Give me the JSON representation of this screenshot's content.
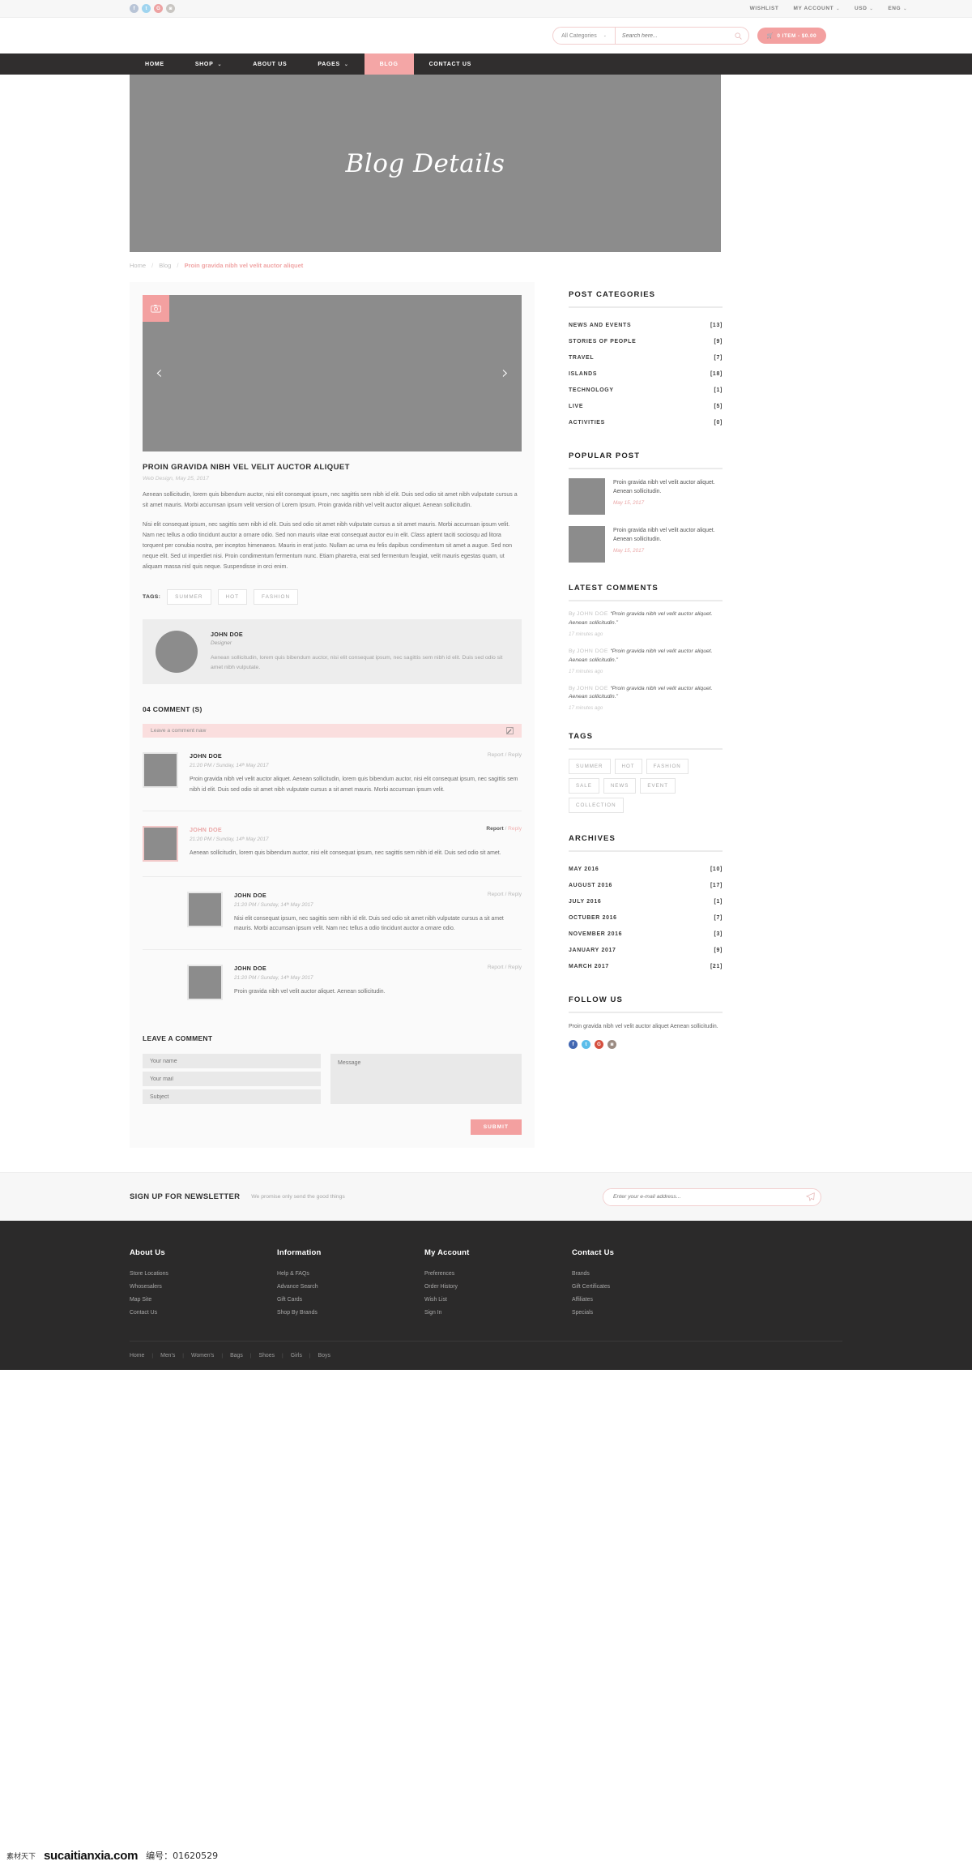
{
  "topbar": {
    "socials": [
      {
        "name": "facebook-icon",
        "glyph": "f"
      },
      {
        "name": "twitter-icon",
        "glyph": "t"
      },
      {
        "name": "googleplus-icon",
        "glyph": "G"
      },
      {
        "name": "instagram-icon",
        "glyph": "◙"
      }
    ],
    "links": [
      {
        "label": "WISHLIST",
        "caret": false
      },
      {
        "label": "MY ACCOUNT",
        "caret": true
      },
      {
        "label": "USD",
        "caret": true
      },
      {
        "label": "ENG",
        "caret": true
      }
    ]
  },
  "header": {
    "category_select": "All Categories",
    "search_placeholder": "Search here...",
    "search_value": "",
    "cart_label": "0 ITEM - $0.00"
  },
  "mainnav": [
    {
      "label": "HOME",
      "caret": false,
      "active": false
    },
    {
      "label": "SHOP",
      "caret": true,
      "active": false
    },
    {
      "label": "ABOUT US",
      "caret": false,
      "active": false
    },
    {
      "label": "PAGES",
      "caret": true,
      "active": false
    },
    {
      "label": "BLOG",
      "caret": false,
      "active": true
    },
    {
      "label": "CONTACT US",
      "caret": false,
      "active": false
    }
  ],
  "hero": {
    "title": "Blog Details"
  },
  "breadcrumb": {
    "home": "Home",
    "blog": "Blog",
    "current": "Proin gravida nibh vel velit auctor aliquet",
    "separator": "/"
  },
  "post": {
    "title": "PROIN GRAVIDA NIBH VEL VELIT AUCTOR ALIQUET",
    "meta": "Web Design, May 25, 2017",
    "paragraph1": "Aenean sollicitudin, lorem quis bibendum auctor, nisi elit consequat ipsum, nec sagittis sem nibh id elit. Duis sed odio sit amet nibh vulputate cursus a sit amet mauris. Morbi accumsan ipsum velit version  of Lorem Ipsum. Proin gravida nibh vel velit auctor aliquet. Aenean sollicitudin.",
    "paragraph2": "Nisi elit consequat ipsum, nec sagittis sem nibh id elit. Duis sed odio sit amet nibh vulputate cursus a sit amet mauris. Morbi accumsan ipsum velit. Nam nec tellus a odio tincidunt auctor a ornare odio. Sed non  mauris vitae erat consequat auctor eu in elit. Class aptent taciti sociosqu ad litora torquent per conubia nostra, per inceptos himenaeos. Mauris in erat justo. Nullam ac urna eu felis dapibus condimentum sit amet a augue. Sed non neque elit. Sed ut imperdiet nisi. Proin condimentum fermentum nunc. Etiam pharetra, erat sed fermentum feugiat, velit mauris egestas quam, ut aliquam massa nisl quis neque. Suspendisse in orci enim.",
    "tags_label": "TAGS:",
    "tags": [
      "SUMMER",
      "HOT",
      "FASHION"
    ],
    "slider_prev": "‹",
    "slider_next": "›"
  },
  "author": {
    "name": "JOHN DOE",
    "role": "Designer",
    "text": "Aenean sollicitudin, lorem quis bibendum auctor, nisi elit consequat ipsum, nec sagittis sem nibh id elit. Duis sed odio sit amet nibh vulputate."
  },
  "comments": {
    "heading": "04 COMMENT (S)",
    "leave_bar": "Leave a comment naw",
    "report_label": "Report",
    "reply_label": "Reply",
    "action_sep": "/",
    "items": [
      {
        "name": "JOHN DOE",
        "date": "21:20 PM / Sunday, 14ᵗʰ May 2017",
        "text": "Proin gravida nibh vel velit auctor aliquet. Aenean sollicitudin, lorem quis bibendum auctor, nisi elit consequat ipsum, nec sagittis sem nibh id elit. Duis sed odio sit amet nibh vulputate cursus a sit amet mauris. Morbi accumsan ipsum velit.",
        "indent": 0,
        "highlight": false
      },
      {
        "name": "JOHN DOE",
        "date": "21:20 PM / Sunday, 14ᵗʰ May 2017",
        "text": "Aenean sollicitudin, lorem quis bibendum auctor, nisi elit consequat ipsum, nec sagittis sem nibh id elit. Duis sed odio sit amet.",
        "indent": 0,
        "highlight": true
      },
      {
        "name": "JOHN DOE",
        "date": "21:20 PM / Sunday, 14ᵗʰ May 2017",
        "text": "Nisi elit consequat ipsum, nec sagittis sem nibh id elit. Duis sed odio sit amet nibh vulputate cursus a sit amet mauris. Morbi accumsan ipsum velit. Nam nec tellus a odio tincidunt auctor a ornare odio.",
        "indent": 1,
        "highlight": false
      },
      {
        "name": "JOHN DOE",
        "date": "21:20 PM / Sunday, 14ᵗʰ May 2017",
        "text": "Proin gravida nibh vel velit auctor aliquet. Aenean sollicitudin.",
        "indent": 1,
        "highlight": false
      }
    ]
  },
  "comment_form": {
    "heading": "LEAVE A COMMENT",
    "name_placeholder": "Your name",
    "mail_placeholder": "Your mail",
    "subject_placeholder": "Subject",
    "message_placeholder": "Message",
    "name_value": "",
    "mail_value": "",
    "subject_value": "",
    "message_value": "",
    "submit_label": "SUBMIT"
  },
  "sidebar": {
    "post_categories": {
      "title": "POST CATEGORIES",
      "items": [
        {
          "label": "NEWS AND EVENTS",
          "count": "[13]"
        },
        {
          "label": "STORIES OF PEOPLE",
          "count": "[9]"
        },
        {
          "label": "TRAVEL",
          "count": "[7]"
        },
        {
          "label": "ISLANDS",
          "count": "[18]"
        },
        {
          "label": "TECHNOLOGY",
          "count": "[1]"
        },
        {
          "label": "LIVE",
          "count": "[5]"
        },
        {
          "label": "ACTIVITIES",
          "count": "[0]"
        }
      ]
    },
    "popular_post": {
      "title": "POPULAR POST",
      "items": [
        {
          "text": "Proin gravida nibh vel velit auctor aliquet. Aenean sollicitudin.",
          "date": "May 15, 2017"
        },
        {
          "text": "Proin gravida nibh vel velit auctor aliquet. Aenean sollicitudin.",
          "date": "May 15, 2017"
        }
      ]
    },
    "latest_comments": {
      "title": "LATEST COMMENTS",
      "by_label": "By",
      "items": [
        {
          "name": "JOHN DOE",
          "quote": "“Proin gravida nibh vel velit auctor aliquet. Aenean sollicitudin.”",
          "time": "17 minutes ago"
        },
        {
          "name": "JOHN DOE",
          "quote": "“Proin gravida nibh vel velit auctor aliquet. Aenean sollicitudin.”",
          "time": "17 minutes ago"
        },
        {
          "name": "JOHN DOE",
          "quote": "“Proin gravida nibh vel velit auctor aliquet. Aenean sollicitudin.”",
          "time": "17 minutes ago"
        }
      ]
    },
    "tags": {
      "title": "TAGS",
      "items": [
        "SUMMER",
        "HOT",
        "FASHION",
        "SALE",
        "NEWS",
        "EVENT",
        "COLLECTION"
      ]
    },
    "archives": {
      "title": "ARCHIVES",
      "items": [
        {
          "label": "MAY 2016",
          "count": "[10]"
        },
        {
          "label": "AUGUST 2016",
          "count": "[17]"
        },
        {
          "label": "JULY 2016",
          "count": "[1]"
        },
        {
          "label": "OCTUBER 2016",
          "count": "[7]"
        },
        {
          "label": "NOVEMBER 2016",
          "count": "[3]"
        },
        {
          "label": "JANUARY 2017",
          "count": "[9]"
        },
        {
          "label": "MARCH 2017",
          "count": "[21]"
        }
      ]
    },
    "follow_us": {
      "title": "FOLLOW US",
      "text": "Proin gravida nibh vel velit auctor aliquet Aenean sollicitudin.",
      "socials": [
        {
          "name": "facebook-icon",
          "glyph": "f"
        },
        {
          "name": "twitter-icon",
          "glyph": "t"
        },
        {
          "name": "googleplus-icon",
          "glyph": "G"
        },
        {
          "name": "instagram-icon",
          "glyph": "◙"
        }
      ]
    }
  },
  "newsletter": {
    "title": "SIGN UP FOR NEWSLETTER",
    "subtitle": "We promise only send the good things",
    "placeholder": "Enter your e-mail address...",
    "value": ""
  },
  "footer": {
    "columns": [
      {
        "title": "About Us",
        "links": [
          "Store Locations",
          "Whosesalers",
          "Map Site",
          "Contact Us"
        ]
      },
      {
        "title": "Information",
        "links": [
          "Help & FAQs",
          "Advance Search",
          "Gift Cards",
          "Shop By Brands"
        ]
      },
      {
        "title": "My Account",
        "links": [
          "Preferences",
          "Order History",
          "Wish List",
          "Sign In"
        ]
      },
      {
        "title": "Contact Us",
        "links": [
          "Brands",
          "Gift Certificates",
          "Affiliates",
          "Specials"
        ]
      }
    ],
    "bottom_links": [
      "Home",
      "Men's",
      "Women's",
      "Bags",
      "Shoes",
      "Girls",
      "Boys"
    ],
    "bottom_separator": "|"
  },
  "watermark": {
    "cn_text": "素材天下",
    "brand": "sucaitianxia.com",
    "id_text": "编号：01620529"
  },
  "colors": {
    "accent": "#f3a0a0",
    "accent_light": "#fadede",
    "dark": "#2b2a2a",
    "nav_dark": "#302e2e",
    "placeholder_gray": "#8c8c8c"
  }
}
